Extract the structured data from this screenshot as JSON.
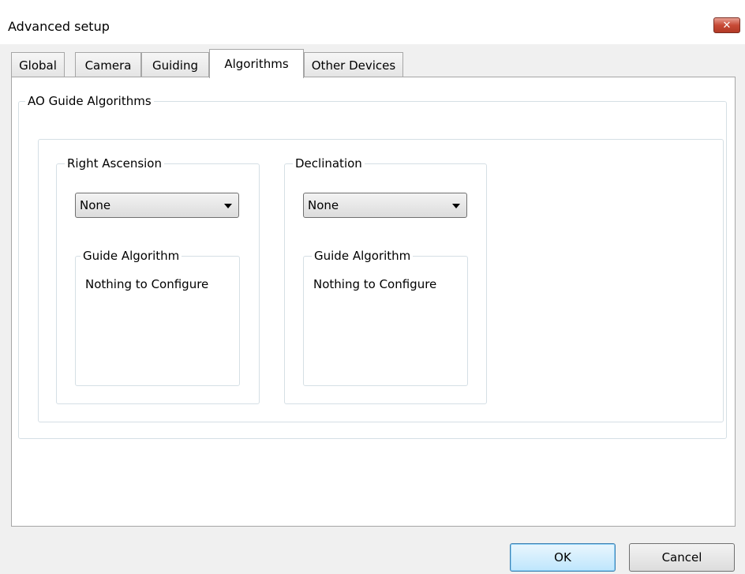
{
  "window": {
    "title": "Advanced setup",
    "close_glyph": "✕"
  },
  "tabs": [
    {
      "label": "Global",
      "active": false
    },
    {
      "label": "Camera",
      "active": false
    },
    {
      "label": "Guiding",
      "active": false
    },
    {
      "label": "Algorithms",
      "active": true
    },
    {
      "label": "Other Devices",
      "active": false
    }
  ],
  "algorithms_panel": {
    "group_title": "AO Guide Algorithms",
    "right_ascension": {
      "label": "Right Ascension",
      "selected": "None",
      "sub_group_title": "Guide Algorithm",
      "message": "Nothing to Configure"
    },
    "declination": {
      "label": "Declination",
      "selected": "None",
      "sub_group_title": "Guide Algorithm",
      "message": "Nothing to Configure"
    }
  },
  "buttons": {
    "ok": "OK",
    "cancel": "Cancel"
  },
  "colors": {
    "close_button": "#c74a36",
    "group_border": "#d5dfe5",
    "panel_background": "#ffffff",
    "dialog_background": "#f0f0f0"
  }
}
